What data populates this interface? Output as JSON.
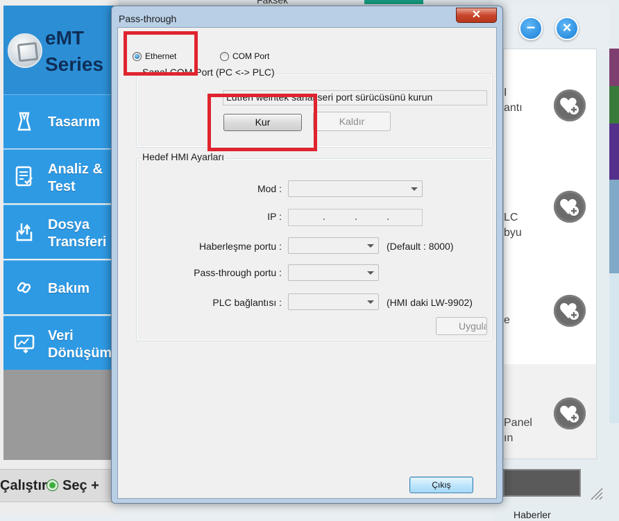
{
  "background_app": {
    "top_partial_text": "Faksek",
    "brand": {
      "line1": "eMT",
      "line2": "Series"
    },
    "nav": [
      {
        "label": "Tasarım",
        "icon": "design-tool-icon"
      },
      {
        "label": "Analiz &\nTest",
        "icon": "checklist-icon"
      },
      {
        "label": "Dosya\nTransferi",
        "icon": "file-transfer-icon"
      },
      {
        "label": "Bakım",
        "icon": "maintenance-link-icon"
      },
      {
        "label": "Veri\nDönüşüm",
        "icon": "data-convert-icon"
      }
    ],
    "bottom_bar": {
      "run": "Çalıştır",
      "select": "Seç +"
    },
    "right_panel": {
      "minimize": "−",
      "close": "×",
      "cards": [
        {
          "text": "I\nantı"
        },
        {
          "text": "LC\nbyu"
        },
        {
          "text": "e"
        },
        {
          "text": "Panel\nın"
        }
      ],
      "footer": "Haberler"
    }
  },
  "dialog": {
    "title": "Pass-through",
    "close_label": "✕",
    "mode": {
      "ethernet_label": "Ethernet",
      "com_port_label": "COM Port",
      "selected": "Ethernet"
    },
    "serial_group": {
      "title": "Sanal COM Port (PC <-> PLC)",
      "info": "Lütfen weintek sanal seri port sürücüsünü kurun",
      "install_button": "Kur",
      "remove_button": "Kaldır"
    },
    "hmi_group": {
      "title": "Hedef HMI Ayarları",
      "mode_label": "Mod :",
      "mode_value": "",
      "ip_label": "IP :",
      "ip_value": "",
      "comm_port_label": "Haberleşme portu :",
      "comm_port_value": "",
      "comm_port_hint": "(Default : 8000)",
      "pass_port_label": "Pass-through portu :",
      "pass_port_value": "",
      "plc_conn_label": "PLC bağlantısı :",
      "plc_conn_value": "",
      "plc_conn_hint": "(HMI daki LW-9902)",
      "apply_button": "Uygula"
    },
    "exit_button": "Çıkış"
  },
  "colors": {
    "nav_blue": "#2f9ae4",
    "brand_text": "#0e2e57",
    "annotation_red": "#e0242f",
    "dialog_frame": "#b9cfe6"
  }
}
